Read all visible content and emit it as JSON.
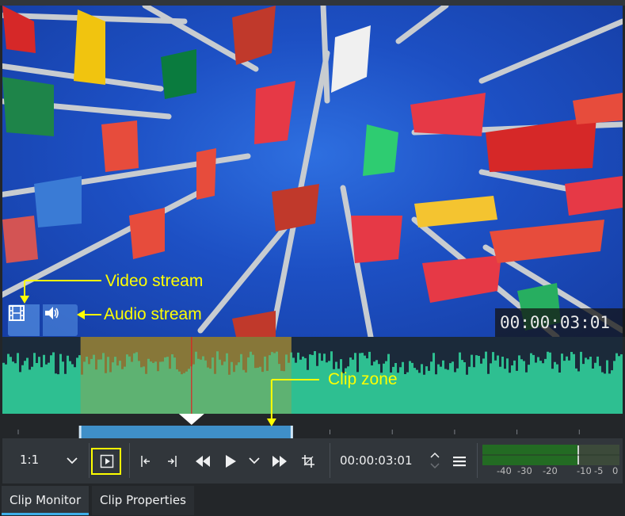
{
  "monitor": {
    "timecode_overlay": "00:00:03:01",
    "zoom": "1:1",
    "timecode": "00:00:03:01",
    "playhead_fraction": 0.305,
    "zone_start_fraction": 0.126,
    "zone_end_fraction": 0.466
  },
  "annotations": {
    "video_stream": "Video stream",
    "audio_stream": "Audio stream",
    "clip_zone": "Clip zone"
  },
  "meter": {
    "scale": [
      "-40",
      "-30",
      "-20",
      "-10",
      "-5",
      "0"
    ]
  },
  "tabs": [
    "Clip Monitor",
    "Clip Properties"
  ],
  "icons": {
    "video_stream": "film-icon",
    "audio_stream": "speaker-icon",
    "zoom_dropdown": "chevron-down-icon",
    "zone_toggle": "play-in-box-icon",
    "set_in": "set-zone-in-icon",
    "set_out": "set-zone-out-icon",
    "rewind": "rewind-icon",
    "play": "play-icon",
    "play_options": "chevron-down-icon",
    "forward": "fast-forward-icon",
    "crop": "crop-icon",
    "timecode_spin": "up-down-arrows-icon",
    "menu": "hamburger-icon"
  },
  "colors": {
    "annotation": "#ffff00",
    "waveform": "#2ebf91",
    "zone": "#3f8fc8",
    "playhead": "#e02020",
    "accent": "#3daee9"
  }
}
